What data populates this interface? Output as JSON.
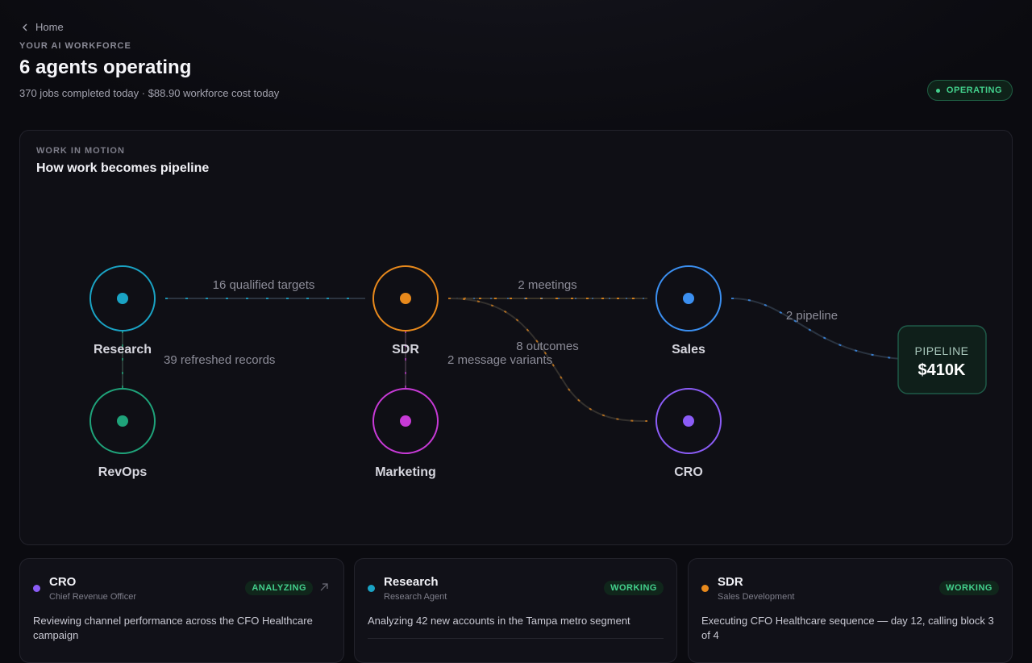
{
  "nav": {
    "back_label": "Home"
  },
  "header": {
    "kicker": "YOUR AI WORKFORCE",
    "title": "6 agents operating",
    "subtitle": "370 jobs completed today · $88.90 workforce cost today",
    "status": "OPERATING"
  },
  "flow_panel": {
    "kicker": "WORK IN MOTION",
    "title": "How work becomes pipeline",
    "nodes": {
      "research": {
        "label": "Research",
        "color": "#1aa3c4"
      },
      "sdr": {
        "label": "SDR",
        "color": "#e8891c"
      },
      "sales": {
        "label": "Sales",
        "color": "#3b8ff0"
      },
      "revops": {
        "label": "RevOps",
        "color": "#1fa37a"
      },
      "marketing": {
        "label": "Marketing",
        "color": "#c73ad6"
      },
      "cro": {
        "label": "CRO",
        "color": "#8b5cf6"
      }
    },
    "edges": {
      "research_sdr": "16 qualified targets",
      "research_revops": "39 refreshed records",
      "sdr_sales": "2 meetings",
      "sdr_cro": "8 outcomes",
      "sdr_marketing": "2 message variants",
      "sales_pipeline": "2 pipeline"
    },
    "pipeline": {
      "label": "PIPELINE",
      "value": "$410K"
    }
  },
  "agents": [
    {
      "name": "CRO",
      "role": "Chief Revenue Officer",
      "status": "ANALYZING",
      "color": "#8b5cf6",
      "description": "Reviewing channel performance across the CFO Healthcare campaign"
    },
    {
      "name": "Research",
      "role": "Research Agent",
      "status": "WORKING",
      "color": "#1aa3c4",
      "description": "Analyzing 42 new accounts in the Tampa metro segment"
    },
    {
      "name": "SDR",
      "role": "Sales Development",
      "status": "WORKING",
      "color": "#e8891c",
      "description": "Executing CFO Healthcare sequence — day 12, calling block 3 of 4"
    }
  ]
}
